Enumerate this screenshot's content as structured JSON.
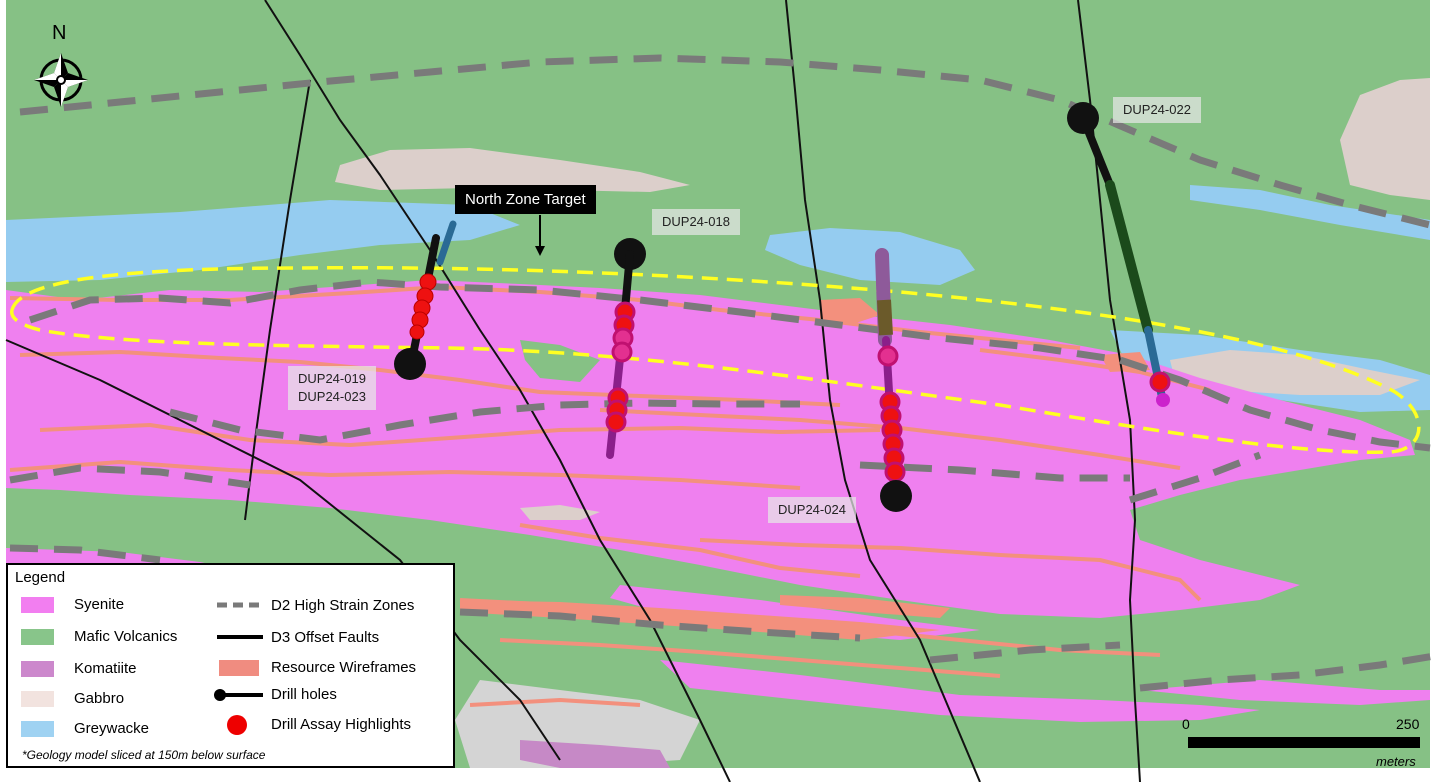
{
  "north_label": "N",
  "target_label": "North Zone Target",
  "drill_hole_labels": {
    "dup24_018": "DUP24-018",
    "dup24_019": "DUP24-019",
    "dup24_023": "DUP24-023",
    "dup24_022": "DUP24-022",
    "dup24_024": "DUP24-024"
  },
  "legend": {
    "title": "Legend",
    "rock_types": [
      {
        "label": "Syenite",
        "color": "#f27ef0"
      },
      {
        "label": "Mafic Volcanics",
        "color": "#88c58a"
      },
      {
        "label": "Komatiite",
        "color": "#cc88cc"
      },
      {
        "label": "Gabbro",
        "color": "#f2e3df"
      },
      {
        "label": "Greywacke",
        "color": "#9fd2f2"
      }
    ],
    "features": [
      {
        "label": "D2 High Strain Zones",
        "icon": "dashed-line"
      },
      {
        "label": "D3 Offset Faults",
        "icon": "solid-line"
      },
      {
        "label": "Resource Wireframes",
        "icon": "salmon-swatch",
        "color": "#f08c80"
      },
      {
        "label": "Drill holes",
        "icon": "drill-hole-line"
      },
      {
        "label": "Drill Assay Highlights",
        "icon": "red-dot",
        "color": "#ee0000"
      }
    ],
    "note": "*Geology model sliced at 150m below surface"
  },
  "scale": {
    "start": "0",
    "end": "250",
    "unit": "meters"
  },
  "colors": {
    "mafic": "#86c185",
    "syenite": "#ef80ef",
    "komatiite": "#c689c6",
    "gabbro": "#dccfcb",
    "greywacke": "#95ccf0",
    "wireframe": "#f3907d",
    "assay": "#ee1111",
    "target_outline": "#ffff22"
  }
}
